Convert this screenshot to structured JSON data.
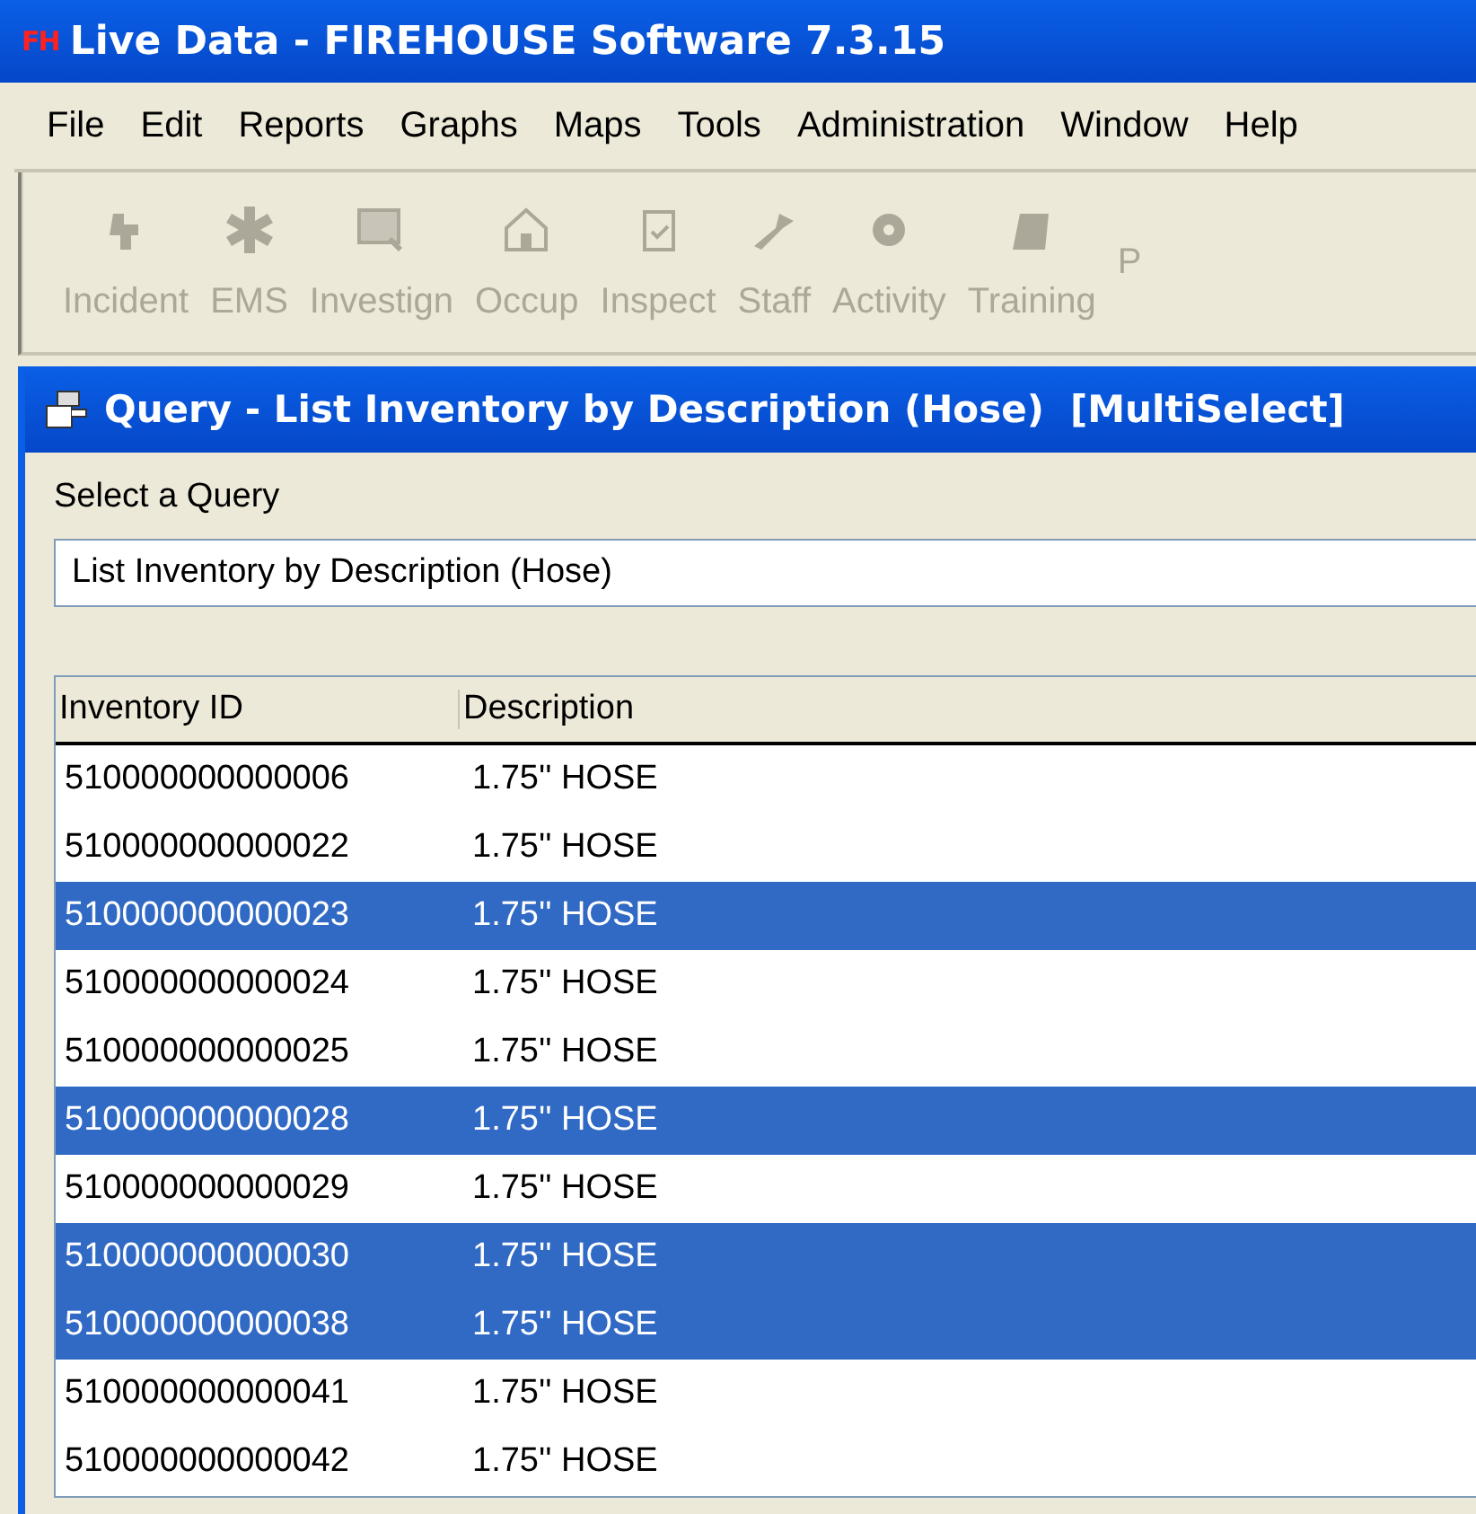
{
  "window": {
    "logo": "FH",
    "title": "Live Data - FIREHOUSE Software 7.3.15"
  },
  "menu": [
    "File",
    "Edit",
    "Reports",
    "Graphs",
    "Maps",
    "Tools",
    "Administration",
    "Window",
    "Help"
  ],
  "toolbar": [
    {
      "label": "Incident",
      "disabled": true
    },
    {
      "label": "EMS",
      "disabled": true
    },
    {
      "label": "Investign",
      "disabled": true
    },
    {
      "label": "Occup",
      "disabled": true
    },
    {
      "label": "Inspect",
      "disabled": true
    },
    {
      "label": "Staff",
      "disabled": true
    },
    {
      "label": "Activity",
      "disabled": true
    },
    {
      "label": "Training",
      "disabled": true
    },
    {
      "label": "P",
      "disabled": true
    }
  ],
  "query_window": {
    "title": "Query - List Inventory by Description (Hose)  [MultiSelect]",
    "select_label": "Select a Query",
    "select_value": "List Inventory by Description (Hose)",
    "table": {
      "columns": [
        "Inventory ID",
        "Description"
      ],
      "rows": [
        {
          "id": "510000000000006",
          "description": "1.75'' HOSE",
          "selected": false
        },
        {
          "id": "510000000000022",
          "description": "1.75'' HOSE",
          "selected": false
        },
        {
          "id": "510000000000023",
          "description": "1.75'' HOSE",
          "selected": true
        },
        {
          "id": "510000000000024",
          "description": "1.75'' HOSE",
          "selected": false
        },
        {
          "id": "510000000000025",
          "description": "1.75'' HOSE",
          "selected": false
        },
        {
          "id": "510000000000028",
          "description": "1.75'' HOSE",
          "selected": true
        },
        {
          "id": "510000000000029",
          "description": "1.75'' HOSE",
          "selected": false
        },
        {
          "id": "510000000000030",
          "description": "1.75'' HOSE",
          "selected": true
        },
        {
          "id": "510000000000038",
          "description": "1.75'' HOSE",
          "selected": true
        },
        {
          "id": "510000000000041",
          "description": "1.75'' HOSE",
          "selected": false
        },
        {
          "id": "510000000000042",
          "description": "1.75'' HOSE",
          "selected": false
        }
      ]
    }
  }
}
